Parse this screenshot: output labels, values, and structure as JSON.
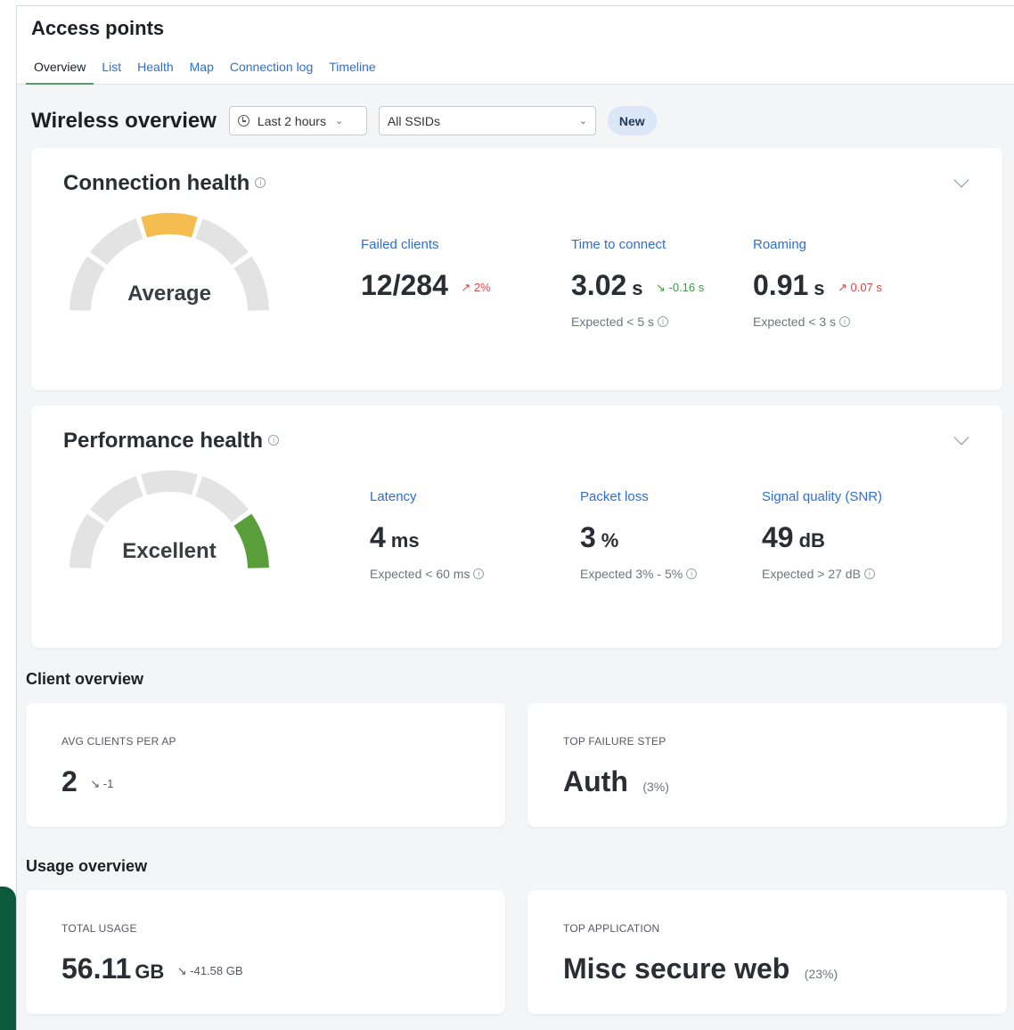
{
  "page": {
    "title": "Access points",
    "tabs": [
      "Overview",
      "List",
      "Health",
      "Map",
      "Connection log",
      "Timeline"
    ],
    "active_tab": "Overview"
  },
  "wireless": {
    "title": "Wireless overview",
    "time_range": "Last 2 hours",
    "ssid": "All SSIDs",
    "badge": "New"
  },
  "connection_health": {
    "title": "Connection health",
    "gauge_label": "Average",
    "gauge_color": "#f5bd4f",
    "metrics": [
      {
        "label": "Failed clients",
        "value": "12/284",
        "unit": "",
        "trend": "↗ 2%",
        "trend_dir": "up",
        "expected": ""
      },
      {
        "label": "Time to connect",
        "value": "3.02",
        "unit": "s",
        "trend": "↘ -0.16 s",
        "trend_dir": "down",
        "expected": "Expected < 5 s"
      },
      {
        "label": "Roaming",
        "value": "0.91",
        "unit": "s",
        "trend": "↗ 0.07 s",
        "trend_dir": "up",
        "expected": "Expected < 3 s"
      }
    ]
  },
  "performance_health": {
    "title": "Performance health",
    "gauge_label": "Excellent",
    "gauge_color": "#5a9e3c",
    "metrics": [
      {
        "label": "Latency",
        "value": "4",
        "unit": "ms",
        "expected": "Expected < 60 ms"
      },
      {
        "label": "Packet loss",
        "value": "3",
        "unit": "%",
        "expected": "Expected 3% - 5%"
      },
      {
        "label": "Signal quality (SNR)",
        "value": "49",
        "unit": "dB",
        "expected": "Expected > 27 dB"
      }
    ]
  },
  "client_overview": {
    "heading": "Client overview",
    "avg_clients": {
      "label": "AVG CLIENTS PER AP",
      "value": "2",
      "delta": "↘ -1"
    },
    "top_failure": {
      "label": "TOP FAILURE STEP",
      "value": "Auth",
      "pct": "(3%)"
    }
  },
  "usage_overview": {
    "heading": "Usage overview",
    "total_usage": {
      "label": "TOTAL USAGE",
      "value": "56.11",
      "unit": "GB",
      "delta": "↘ -41.58 GB"
    },
    "top_app": {
      "label": "TOP APPLICATION",
      "value": "Misc secure web",
      "pct": "(23%)"
    }
  },
  "colors": {
    "accent": "#2f6fd1",
    "up": "#e04646",
    "down": "#3b9b3b",
    "gauge_track": "#e3e3e3"
  }
}
